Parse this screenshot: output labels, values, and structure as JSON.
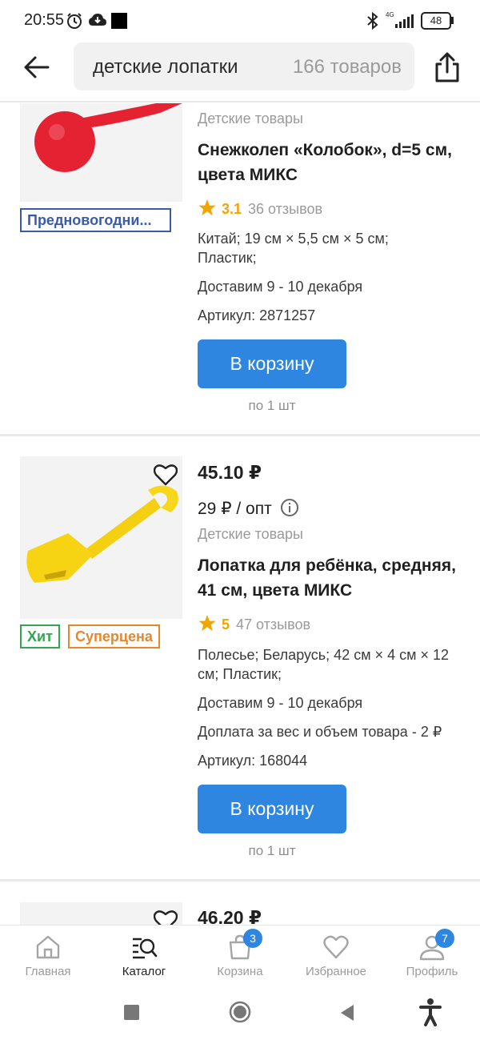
{
  "status_bar": {
    "time": "20:55",
    "battery": "48",
    "network": "4G"
  },
  "header": {
    "search_query": "детские лопатки",
    "result_count": "166 товаров",
    "icons": [
      "back-arrow-icon",
      "share-icon"
    ]
  },
  "products": [
    {
      "category": "Детские товары",
      "title": "Снежколеп «Колобок», d=5 см, цвета МИКС",
      "rating": "3.1",
      "reviews": "36 отзывов",
      "specs": "Китай; 19 см × 5,5 см × 5 см; Пластик;",
      "delivery": "Доставим 9 - 10 декабря",
      "sku": "Артикул: 2871257",
      "badges": [
        "Предновогодни..."
      ],
      "cart_label": "В корзину",
      "unit": "по 1 шт"
    },
    {
      "price": "45.10 ₽",
      "wholesale": "29 ₽ / опт",
      "category": "Детские товары",
      "title": "Лопатка для ребёнка, средняя, 41 см, цвета МИКС",
      "rating": "5",
      "reviews": "47 отзывов",
      "specs": "Полесье; Беларусь; 42 см × 4 см × 12 см; Пластик;",
      "delivery": "Доставим 9 - 10 декабря",
      "surcharge": "Доплата за вес и объем товара - 2 ₽",
      "sku": "Артикул: 168044",
      "badges": [
        "Хит",
        "Суперцена"
      ],
      "cart_label": "В корзину",
      "unit": "по 1 шт"
    },
    {
      "price": "46.20 ₽"
    }
  ],
  "bottom_nav": {
    "items": [
      {
        "label": "Главная",
        "icon": "home-icon"
      },
      {
        "label": "Каталог",
        "icon": "catalog-search-icon"
      },
      {
        "label": "Корзина",
        "icon": "cart-bag-icon",
        "badge": "3"
      },
      {
        "label": "Избранное",
        "icon": "heart-icon"
      },
      {
        "label": "Профиль",
        "icon": "profile-icon",
        "badge": "7"
      }
    ],
    "active_index": 1
  },
  "colors": {
    "accent": "#2f86e0",
    "star": "#f2a400",
    "badge_blue": "#3a5ba8",
    "badge_green": "#2fa84e",
    "badge_orange": "#e8862a"
  }
}
